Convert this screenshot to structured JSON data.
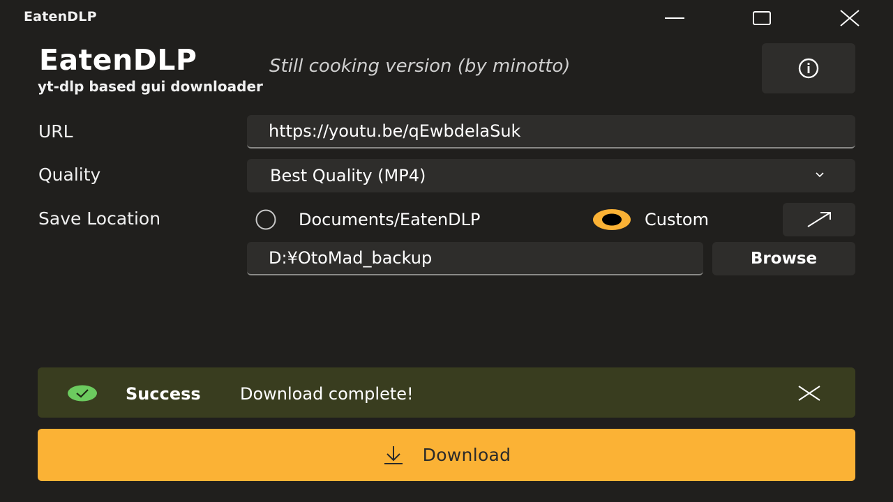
{
  "window": {
    "title": "EatenDLP",
    "controls": {
      "minimize_icon": "minimize-icon",
      "maximize_icon": "maximize-icon",
      "close_icon": "close-icon"
    }
  },
  "header": {
    "app_name": "EatenDLP",
    "tagline": "Still cooking version (by minotto)",
    "subtitle": "yt-dlp based gui downloader",
    "info_icon": "info-icon"
  },
  "form": {
    "url": {
      "label": "URL",
      "value": "https://youtu.be/qEwbdelaSuk"
    },
    "quality": {
      "label": "Quality",
      "selected": "Best Quality (MP4)"
    },
    "save_location": {
      "label": "Save Location",
      "options": [
        {
          "label": "Documents/EatenDLP",
          "checked": false
        },
        {
          "label": "Custom",
          "checked": true
        }
      ],
      "open_icon": "arrow-up-right-icon",
      "path": "D:¥OtoMad_backup",
      "browse_label": "Browse"
    }
  },
  "notification": {
    "severity": "Success",
    "message": "Download complete!",
    "icon": "check-circle-icon"
  },
  "actions": {
    "download_label": "Download",
    "download_icon": "download-icon"
  },
  "colors": {
    "accent": "#fbb235",
    "background": "#201f1d",
    "control_bg": "#2e2d2b",
    "success_bg": "#393d1f",
    "success_icon": "#6ccb5f"
  }
}
